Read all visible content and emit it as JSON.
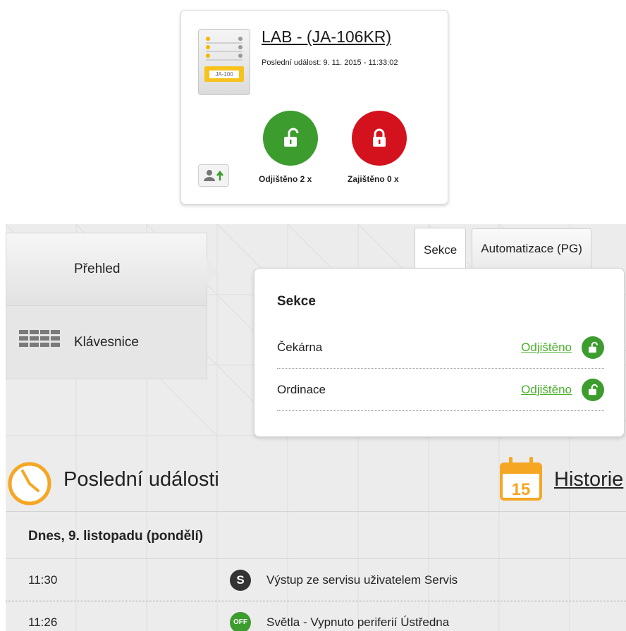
{
  "device": {
    "title": "LAB - (JA-106KR)",
    "last_event": "Poslední událost: 9. 11. 2015 - 11:33:02",
    "thumb_label": "JA-100",
    "unlocked_label": "Odjištěno 2 x",
    "locked_label": "Zajištěno 0 x",
    "colors": {
      "unlocked": "#3c9c2e",
      "locked": "#d3121d",
      "thumb_plate": "#f7c21b"
    }
  },
  "nav": {
    "items": [
      {
        "label": "Přehled",
        "active": true
      },
      {
        "label": "Klávesnice",
        "icon": "keypad-icon"
      }
    ]
  },
  "tabs": [
    {
      "label": "Sekce",
      "active": true
    },
    {
      "label": "Automatizace (PG)"
    }
  ],
  "sections": {
    "title": "Sekce",
    "rows": [
      {
        "name": "Čekárna",
        "status": "Odjištěno",
        "icon": "unlock-icon"
      },
      {
        "name": "Ordinace",
        "status": "Odjištěno",
        "icon": "unlock-icon"
      }
    ],
    "status_color": "#49b02c"
  },
  "events": {
    "title": "Poslední události",
    "history_label": "Historie",
    "calendar_day": "15",
    "day_heading": "Dnes, 9. listopadu (pondělí)",
    "items": [
      {
        "time": "11:30",
        "icon_text": "S",
        "icon": "service-icon",
        "text": "Výstup ze servisu uživatelem Servis"
      },
      {
        "time": "11:26",
        "icon_text": "OFF",
        "icon": "off-icon",
        "text": "Světla - Vypnuto periferií Ústředna"
      }
    ],
    "accent": "#f5a623"
  }
}
